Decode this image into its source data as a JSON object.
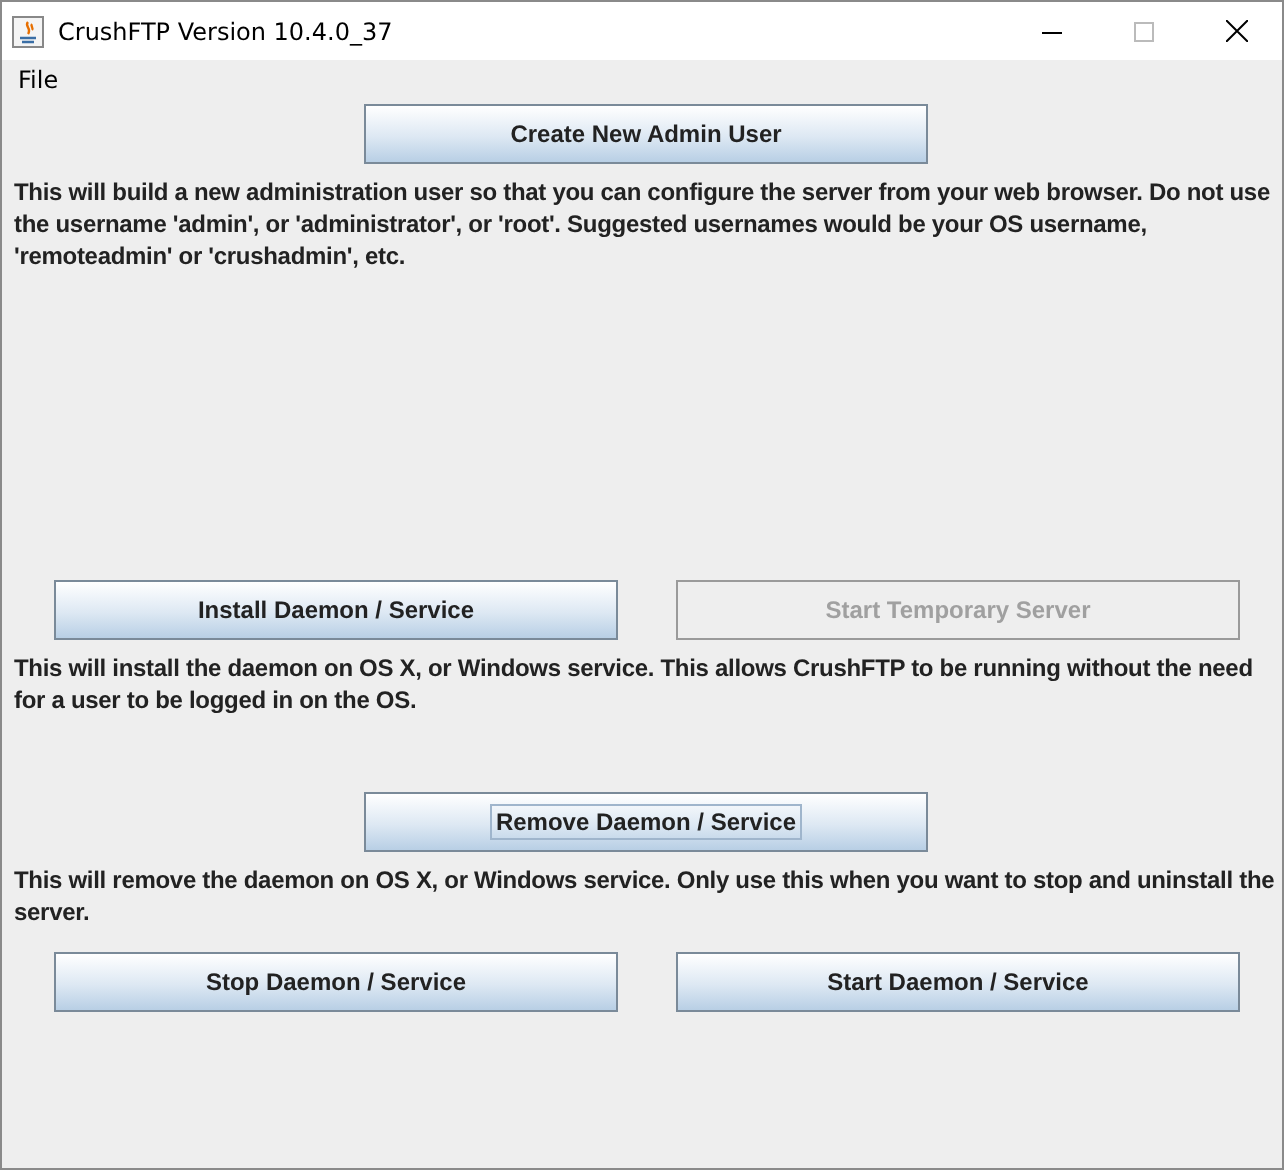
{
  "window": {
    "title": "CrushFTP Version 10.4.0_37"
  },
  "menu": [
    {
      "label": "File"
    }
  ],
  "sections": [
    {
      "kind": "center",
      "buttons": [
        {
          "label": "Create New Admin User",
          "disabled": false,
          "focused": false
        }
      ],
      "description": "This will build a new administration user so that you can configure the server from your web browser. Do not use the username 'admin', or 'administrator', or 'root'. Suggested usernames would be your OS username, 'remoteadmin' or 'crushadmin', etc."
    },
    {
      "kind": "pair",
      "buttons": [
        {
          "label": "Install Daemon / Service",
          "disabled": false,
          "focused": false
        },
        {
          "label": "Start Temporary Server",
          "disabled": true,
          "focused": false
        }
      ],
      "description": "This will install the daemon on OS X, or Windows service. This allows CrushFTP to be running without the need for a user to be logged in on the OS."
    },
    {
      "kind": "center",
      "buttons": [
        {
          "label": "Remove Daemon / Service",
          "disabled": false,
          "focused": true
        }
      ],
      "description": "This will remove the daemon on OS X, or Windows service. Only use this when you want to stop and uninstall the server."
    },
    {
      "kind": "pair",
      "buttons": [
        {
          "label": "Stop Daemon / Service",
          "disabled": false,
          "focused": false
        },
        {
          "label": "Start Daemon / Service",
          "disabled": false,
          "focused": false
        }
      ]
    }
  ]
}
